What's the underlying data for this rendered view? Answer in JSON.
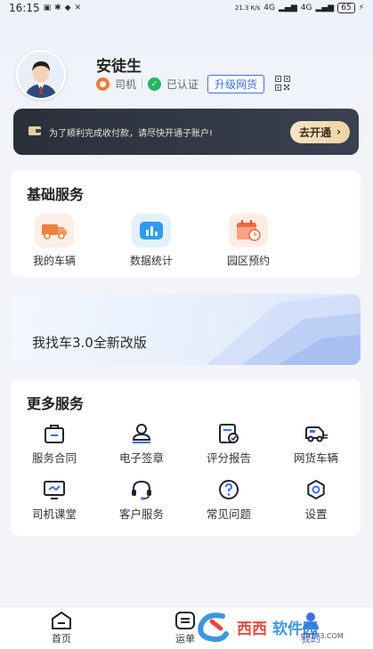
{
  "status_bar": {
    "time": "16:15",
    "speed": "21.3 K/s",
    "network_4g": "4G",
    "battery": "65"
  },
  "profile": {
    "name": "安徒生",
    "role": "司机",
    "certified": "已认证",
    "upgrade_label": "升级网货"
  },
  "pay_banner": {
    "text": "为了顺利完成收付款，请尽快开通子账户!",
    "button_label": "去开通"
  },
  "basic_services": {
    "title": "基础服务",
    "items": [
      {
        "label": "我的车辆",
        "icon": "truck-icon"
      },
      {
        "label": "数据统计",
        "icon": "bar-chart-icon"
      },
      {
        "label": "园区预约",
        "icon": "calendar-clock-icon"
      }
    ]
  },
  "promo": {
    "text": "我找车3.0全新改版"
  },
  "more_services": {
    "title": "更多服务",
    "items": [
      {
        "label": "服务合同",
        "icon": "briefcase-icon"
      },
      {
        "label": "电子签章",
        "icon": "stamp-icon"
      },
      {
        "label": "评分报告",
        "icon": "report-icon"
      },
      {
        "label": "网货车辆",
        "icon": "van-icon"
      },
      {
        "label": "司机课堂",
        "icon": "video-screen-icon"
      },
      {
        "label": "客户服务",
        "icon": "headset-icon"
      },
      {
        "label": "常见问题",
        "icon": "question-icon"
      },
      {
        "label": "设置",
        "icon": "gear-icon"
      }
    ]
  },
  "bottom_nav": {
    "items": [
      {
        "label": "首页"
      },
      {
        "label": "运单"
      },
      {
        "label": "我的"
      }
    ],
    "active": "我的"
  },
  "watermark": {
    "text_a": "西西",
    "text_b": "软件园",
    "url": "CR173.COM"
  },
  "colors": {
    "accent": "#3e6fe6",
    "banner_bg": "#2a2f3a",
    "banner_button": "#f2dcb5",
    "orange": "#f27b35",
    "green": "#27b463"
  }
}
